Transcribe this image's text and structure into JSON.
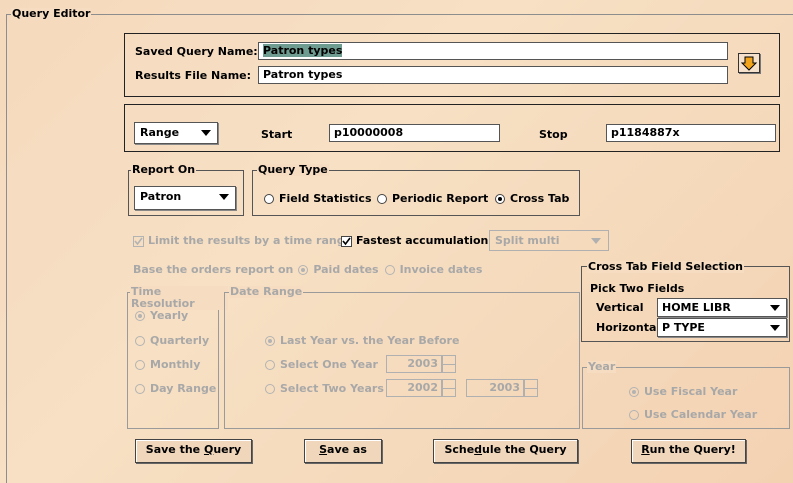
{
  "frame_title": "Query Editor",
  "saved_query": {
    "label": "Saved Query Name:",
    "value": "Patron types"
  },
  "results_file": {
    "label": "Results File Name:",
    "value": "Patron types"
  },
  "range": {
    "selector": "Range",
    "start_label": "Start",
    "start_value": "p10000008",
    "stop_label": "Stop",
    "stop_value": "p1184887x"
  },
  "report_on": {
    "title": "Report On",
    "selected": "Patron"
  },
  "query_type": {
    "title": "Query Type",
    "options": [
      "Field Statistics",
      "Periodic Report",
      "Cross Tab"
    ],
    "selected": "Cross Tab"
  },
  "limit_results": {
    "label": "Limit the results by a time range",
    "checked": true,
    "enabled": false
  },
  "fastest_accumulation": {
    "label": "Fastest accumulation",
    "checked": true
  },
  "split_multi": {
    "value": "Split multi",
    "enabled": false
  },
  "orders_report": {
    "label": "Base the orders report on",
    "options": [
      "Paid dates",
      "Invoice dates"
    ],
    "selected": "Paid dates"
  },
  "time_resolution": {
    "title": "Time Resolutior",
    "options": [
      "Yearly",
      "Quarterly",
      "Monthly",
      "Day Range"
    ],
    "selected": "Yearly"
  },
  "date_range": {
    "title": "Date Range",
    "options": [
      "Last Year vs. the Year Before",
      "Select One Year",
      "Select Two Years"
    ],
    "selected": "Last Year vs. the Year Before",
    "one_year": "2003",
    "two_years_from": "2002",
    "two_years_to": "2003"
  },
  "cross_tab": {
    "title": "Cross Tab Field Selection",
    "subtitle": "Pick Two Fields",
    "vertical_label": "Vertical",
    "vertical_value": "HOME LIBR",
    "horizontal_label": "Horizontal",
    "horizontal_value": "P TYPE"
  },
  "year": {
    "title": "Year",
    "options": [
      "Use Fiscal Year",
      "Use Calendar Year"
    ],
    "selected": "Use Fiscal Year"
  },
  "buttons": {
    "save": {
      "pre": "Save the ",
      "key": "Q",
      "post": "uery"
    },
    "save_as": {
      "pre": "",
      "key": "S",
      "post": "ave as"
    },
    "schedule": {
      "pre": "Sche",
      "key": "d",
      "post": "ule the Query"
    },
    "run": {
      "pre": "",
      "key": "R",
      "post": "un the Query!"
    }
  },
  "icons": {
    "download": "download-arrow-icon",
    "dropdown": "chevron-down-icon",
    "radio": "radio-icon",
    "check": "checkbox-icon"
  },
  "colors": {
    "background": "#f6dcc0",
    "selection": "#6f9c91",
    "accent_arrow": "#f0a020"
  }
}
